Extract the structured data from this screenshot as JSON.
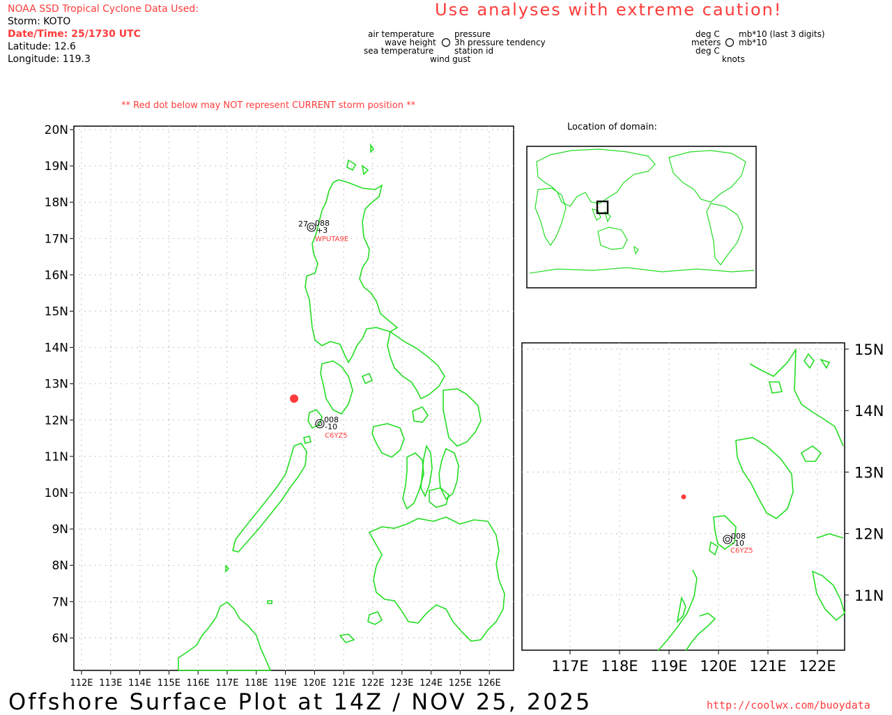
{
  "header": {
    "source": "NOAA SSD Tropical Cyclone Data Used:",
    "storm": "Storm: KOTO",
    "datetime": "Date/Time: 25/1730 UTC",
    "latitude": "Latitude: 12.6",
    "longitude": "Longitude: 119.3",
    "caution": "Use analyses with extreme caution!",
    "note": "** Red dot below may NOT represent CURRENT storm position **"
  },
  "legend": {
    "left": {
      "air_temperature": "air temperature",
      "wave_height": "wave height",
      "sea_temperature": "sea temperature",
      "pressure": "pressure",
      "tendency": "3h pressure tendency",
      "station_id": "station id",
      "wind_gust": "wind gust"
    },
    "right": {
      "deg_c_top": "deg C",
      "meters": "meters",
      "deg_c_bottom": "deg C",
      "mb_last3": "mb*10 (last 3 digits)",
      "mb": "mb*10",
      "knots": "knots"
    }
  },
  "main_map": {
    "lat_labels": [
      "20N",
      "19N",
      "18N",
      "17N",
      "16N",
      "15N",
      "14N",
      "13N",
      "12N",
      "11N",
      "10N",
      "9N",
      "8N",
      "7N",
      "6N"
    ],
    "lon_labels": [
      "112E",
      "113E",
      "114E",
      "115E",
      "116E",
      "117E",
      "118E",
      "119E",
      "120E",
      "121E",
      "122E",
      "123E",
      "124E",
      "125E",
      "126E"
    ],
    "stations": [
      {
        "id": "WPUTA9E",
        "air_temp": "27",
        "pressure": "088",
        "tendency": "+3"
      },
      {
        "id": "C6YZ5",
        "pressure": "008",
        "tendency": "-10"
      }
    ],
    "storm_position": {
      "lat": 12.6,
      "lon": 119.3
    }
  },
  "inset": {
    "title": "Location of domain:"
  },
  "zoom_map": {
    "lat_labels": [
      "15N",
      "14N",
      "13N",
      "12N",
      "11N"
    ],
    "lon_labels": [
      "117E",
      "118E",
      "119E",
      "120E",
      "121E",
      "122E"
    ],
    "stations": [
      {
        "id": "C6YZ5",
        "pressure": "008",
        "tendency": "-10"
      }
    ]
  },
  "footer": {
    "title": "Offshore Surface Plot at 14Z / NOV 25, 2025",
    "url": "http://coolwx.com/buoydata"
  },
  "colors": {
    "coast": "#22dd22",
    "accent_red": "#ff3b3b",
    "grid": "#bbbbbb"
  }
}
